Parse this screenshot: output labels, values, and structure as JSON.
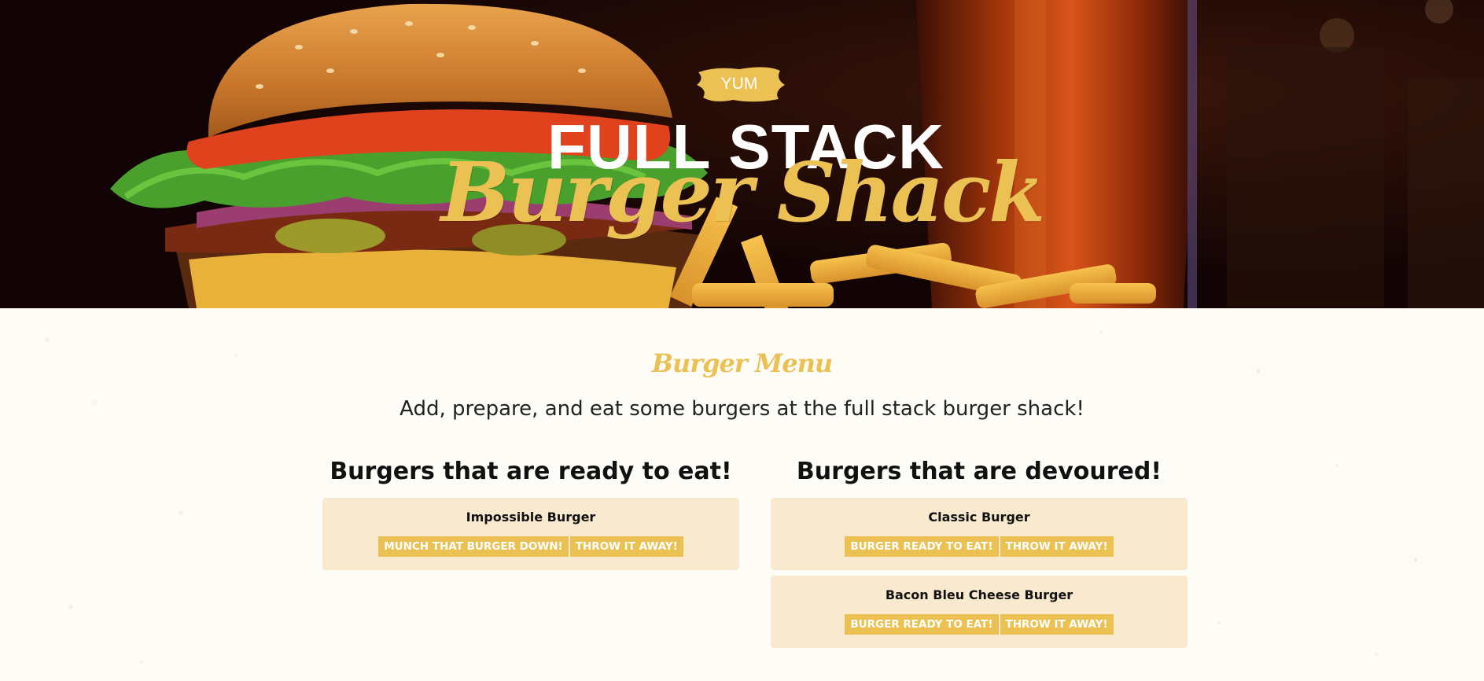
{
  "hero": {
    "badge": "YUM",
    "title_line1": "FULL STACK",
    "title_line2": "Burger Shack"
  },
  "menu": {
    "title": "Burger Menu",
    "subtitle": "Add, prepare, and eat some burgers at the full stack burger shack!"
  },
  "ready_column": {
    "heading": "Burgers that are ready to eat!",
    "burgers": [
      {
        "name": "Impossible Burger",
        "primary_button": "MUNCH THAT BURGER DOWN!",
        "secondary_button": "THROW IT AWAY!"
      }
    ]
  },
  "devoured_column": {
    "heading": "Burgers that are devoured!",
    "burgers": [
      {
        "name": "Classic Burger",
        "primary_button": "BURGER READY TO EAT!",
        "secondary_button": "THROW IT AWAY!"
      },
      {
        "name": "Bacon Bleu Cheese Burger",
        "primary_button": "BURGER READY TO EAT!",
        "secondary_button": "THROW IT AWAY!"
      }
    ]
  },
  "colors": {
    "accent": "#ecc154",
    "card_background": "#f9e9cf",
    "page_background": "#fdfcf7",
    "hero_background": "#1a0806"
  }
}
